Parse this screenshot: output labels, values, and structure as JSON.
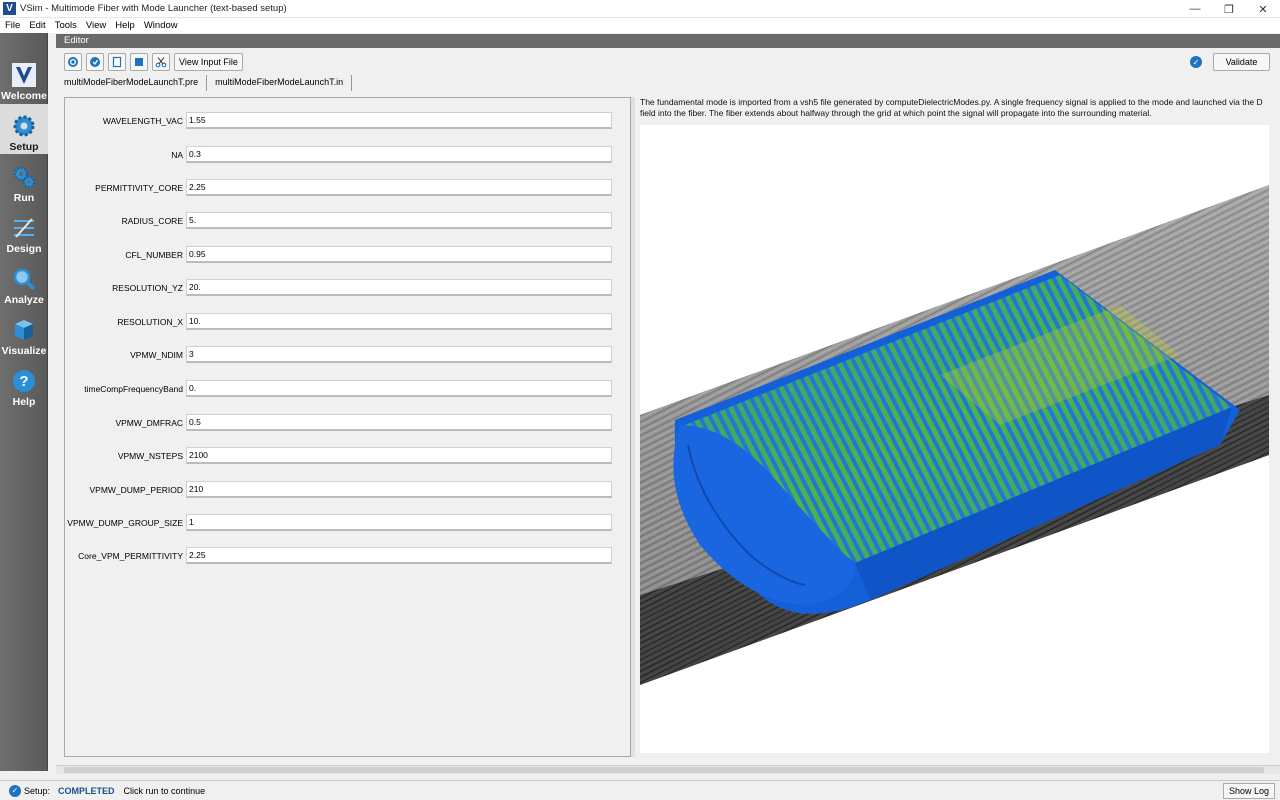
{
  "window": {
    "title": "VSim - Multimode Fiber with Mode Launcher (text-based setup)",
    "app_icon_letter": "V"
  },
  "menu": [
    "File",
    "Edit",
    "Tools",
    "View",
    "Help",
    "Window"
  ],
  "nav": [
    {
      "label": "Welcome",
      "icon": "vsim-logo-icon"
    },
    {
      "label": "Setup",
      "icon": "gear-icon",
      "active": true
    },
    {
      "label": "Run",
      "icon": "gears-run-icon"
    },
    {
      "label": "Design",
      "icon": "design-icon"
    },
    {
      "label": "Analyze",
      "icon": "magnifier-icon"
    },
    {
      "label": "Visualize",
      "icon": "cube-icon"
    },
    {
      "label": "Help",
      "icon": "question-icon"
    }
  ],
  "editor": {
    "header": "Editor",
    "view_input_file_label": "View Input File",
    "validate_label": "Validate",
    "tabs": [
      "multiModeFiberModeLaunchT.pre",
      "multiModeFiberModeLaunchT.in"
    ]
  },
  "parameters": [
    {
      "name": "WAVELENGTH_VAC",
      "value": "1.55"
    },
    {
      "name": "NA",
      "value": "0.3"
    },
    {
      "name": "PERMITTIVITY_CORE",
      "value": "2.25"
    },
    {
      "name": "RADIUS_CORE",
      "value": "5."
    },
    {
      "name": "CFL_NUMBER",
      "value": "0.95"
    },
    {
      "name": "RESOLUTION_YZ",
      "value": "20."
    },
    {
      "name": "RESOLUTION_X",
      "value": "10."
    },
    {
      "name": "VPMW_NDIM",
      "value": "3"
    },
    {
      "name": "timeCompFrequencyBand",
      "value": "0."
    },
    {
      "name": "VPMW_DMFRAC",
      "value": "0.5"
    },
    {
      "name": "VPMW_NSTEPS",
      "value": "2100"
    },
    {
      "name": "VPMW_DUMP_PERIOD",
      "value": "210"
    },
    {
      "name": "VPMW_DUMP_GROUP_SIZE",
      "value": "1"
    },
    {
      "name": "Core_VPM_PERMITTIVITY",
      "value": "2.25"
    }
  ],
  "description": "The fundamental mode is imported from a vsh5 file generated by computeDielectricModes.py. A single frequency signal is applied to the mode and launched via the D field into the fiber. The fiber extends about halfway through the grid at which point the signal will propagate into the surrounding material.",
  "status": {
    "label": "Setup:",
    "state": "COMPLETED",
    "message": "Click run to continue",
    "show_log_label": "Show Log"
  },
  "colors": {
    "nav_bg": "#666666",
    "accent_blue": "#1e73be",
    "fiber_blue": "#1565e0",
    "field_green": "#4fc14a"
  }
}
